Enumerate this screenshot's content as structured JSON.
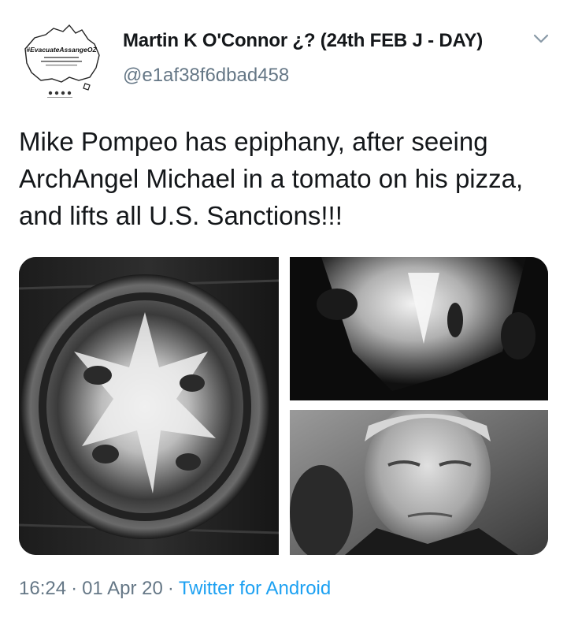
{
  "tweet": {
    "display_name": "Martin K O'Connor ¿? (24th FEB J - DAY)",
    "handle": "@e1af38f6dbad458",
    "text": "Mike Pompeo has epiphany, after seeing ArchAngel Michael in a tomato on his pizza, and lifts all U.S. Sanctions!!!",
    "avatar_text": "#EvacuateAssangeOZ",
    "media": [
      {
        "subject": "tomato-slice-closeup"
      },
      {
        "subject": "tomato-slice-detail"
      },
      {
        "subject": "pompeo-portrait"
      }
    ],
    "meta": {
      "time": "16:24",
      "separator": "·",
      "date": "01 Apr 20",
      "source": "Twitter for Android"
    }
  },
  "colors": {
    "text_primary": "#14171a",
    "text_secondary": "#657786",
    "link": "#1da1f2"
  },
  "icons": {
    "caret": "chevron-down-icon"
  }
}
